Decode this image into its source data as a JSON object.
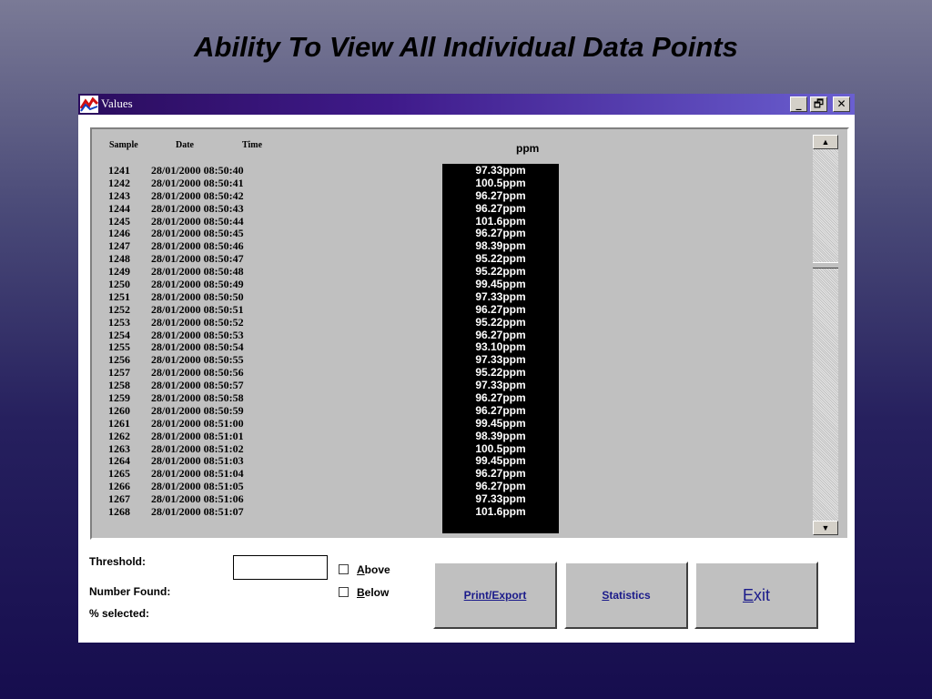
{
  "slide": {
    "title": "Ability To View All Individual Data Points"
  },
  "window": {
    "title": "Values",
    "controls": {
      "minimize": "_",
      "restore": "🗗",
      "close": "✕"
    }
  },
  "table": {
    "headers": {
      "sample": "Sample",
      "date": "Date",
      "time": "Time",
      "ppm": "ppm"
    },
    "rows": [
      {
        "sample": "1241",
        "datetime": "28/01/2000 08:50:40",
        "ppm": "97.33ppm"
      },
      {
        "sample": "1242",
        "datetime": "28/01/2000 08:50:41",
        "ppm": "100.5ppm"
      },
      {
        "sample": "1243",
        "datetime": "28/01/2000 08:50:42",
        "ppm": "96.27ppm"
      },
      {
        "sample": "1244",
        "datetime": "28/01/2000 08:50:43",
        "ppm": "96.27ppm"
      },
      {
        "sample": "1245",
        "datetime": "28/01/2000 08:50:44",
        "ppm": "101.6ppm"
      },
      {
        "sample": "1246",
        "datetime": "28/01/2000 08:50:45",
        "ppm": "96.27ppm"
      },
      {
        "sample": "1247",
        "datetime": "28/01/2000 08:50:46",
        "ppm": "98.39ppm"
      },
      {
        "sample": "1248",
        "datetime": "28/01/2000 08:50:47",
        "ppm": "95.22ppm"
      },
      {
        "sample": "1249",
        "datetime": "28/01/2000 08:50:48",
        "ppm": "95.22ppm"
      },
      {
        "sample": "1250",
        "datetime": "28/01/2000 08:50:49",
        "ppm": "99.45ppm"
      },
      {
        "sample": "1251",
        "datetime": "28/01/2000 08:50:50",
        "ppm": "97.33ppm"
      },
      {
        "sample": "1252",
        "datetime": "28/01/2000 08:50:51",
        "ppm": "96.27ppm"
      },
      {
        "sample": "1253",
        "datetime": "28/01/2000 08:50:52",
        "ppm": "95.22ppm"
      },
      {
        "sample": "1254",
        "datetime": "28/01/2000 08:50:53",
        "ppm": "96.27ppm"
      },
      {
        "sample": "1255",
        "datetime": "28/01/2000 08:50:54",
        "ppm": "93.10ppm"
      },
      {
        "sample": "1256",
        "datetime": "28/01/2000 08:50:55",
        "ppm": "97.33ppm"
      },
      {
        "sample": "1257",
        "datetime": "28/01/2000 08:50:56",
        "ppm": "95.22ppm"
      },
      {
        "sample": "1258",
        "datetime": "28/01/2000 08:50:57",
        "ppm": "97.33ppm"
      },
      {
        "sample": "1259",
        "datetime": "28/01/2000 08:50:58",
        "ppm": "96.27ppm"
      },
      {
        "sample": "1260",
        "datetime": "28/01/2000 08:50:59",
        "ppm": "96.27ppm"
      },
      {
        "sample": "1261",
        "datetime": "28/01/2000 08:51:00",
        "ppm": "99.45ppm"
      },
      {
        "sample": "1262",
        "datetime": "28/01/2000 08:51:01",
        "ppm": "98.39ppm"
      },
      {
        "sample": "1263",
        "datetime": "28/01/2000 08:51:02",
        "ppm": "100.5ppm"
      },
      {
        "sample": "1264",
        "datetime": "28/01/2000 08:51:03",
        "ppm": "99.45ppm"
      },
      {
        "sample": "1265",
        "datetime": "28/01/2000 08:51:04",
        "ppm": "96.27ppm"
      },
      {
        "sample": "1266",
        "datetime": "28/01/2000 08:51:05",
        "ppm": "96.27ppm"
      },
      {
        "sample": "1267",
        "datetime": "28/01/2000 08:51:06",
        "ppm": "97.33ppm"
      },
      {
        "sample": "1268",
        "datetime": "28/01/2000 08:51:07",
        "ppm": "101.6ppm"
      }
    ],
    "scroll_position": 0.31
  },
  "controls": {
    "threshold_label": "Threshold:",
    "threshold_value": "",
    "number_found_label": "Number Found:",
    "percent_selected_label": "% selected:",
    "above": {
      "accel": "A",
      "rest": "bove",
      "checked": false
    },
    "below": {
      "accel": "B",
      "rest": "elow",
      "checked": false
    }
  },
  "buttons": {
    "print": {
      "accel": "P",
      "rest": "rint/Export"
    },
    "statistics": {
      "accel": "S",
      "rest": "tatistics"
    },
    "exit": {
      "accel": "E",
      "rest": "xit"
    }
  }
}
